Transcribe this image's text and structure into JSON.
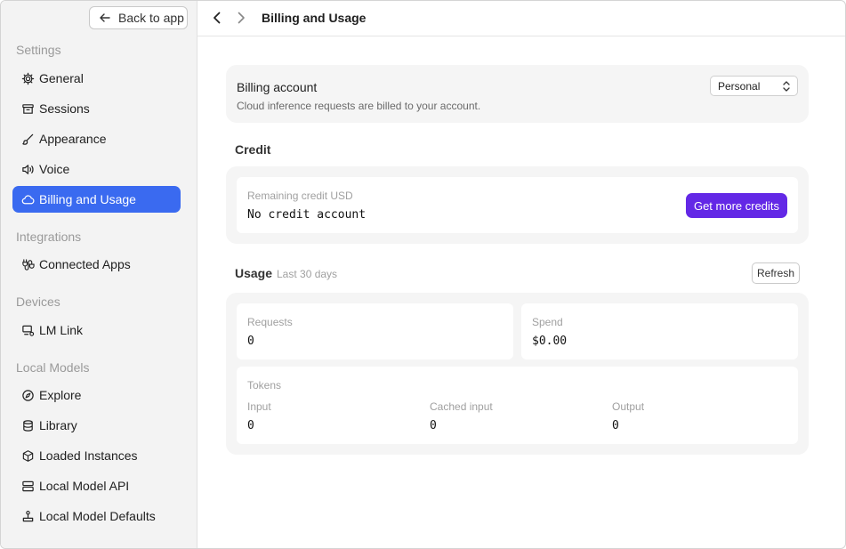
{
  "sidebar": {
    "back_label": "Back to app",
    "sections": {
      "settings": "Settings",
      "integrations": "Integrations",
      "devices": "Devices",
      "local_models": "Local Models"
    },
    "items": {
      "general": "General",
      "sessions": "Sessions",
      "appearance": "Appearance",
      "voice": "Voice",
      "billing": "Billing and Usage",
      "connected_apps": "Connected Apps",
      "lm_link": "LM Link",
      "explore": "Explore",
      "library": "Library",
      "loaded_instances": "Loaded Instances",
      "local_model_api": "Local Model API",
      "local_model_defaults": "Local Model Defaults"
    }
  },
  "header": {
    "title": "Billing and Usage"
  },
  "billing_account": {
    "title": "Billing account",
    "description": "Cloud inference requests are billed to your account.",
    "selected": "Personal"
  },
  "credit": {
    "title": "Credit",
    "label": "Remaining credit USD",
    "value": "No credit account",
    "button": "Get more credits"
  },
  "usage": {
    "title": "Usage",
    "period": "Last 30 days",
    "refresh": "Refresh",
    "requests_label": "Requests",
    "requests_value": "0",
    "spend_label": "Spend",
    "spend_value": "$0.00",
    "tokens_label": "Tokens",
    "input_label": "Input",
    "input_value": "0",
    "cached_label": "Cached input",
    "cached_value": "0",
    "output_label": "Output",
    "output_value": "0"
  },
  "colors": {
    "accent": "#3a6af0",
    "primary_button": "#6328e6"
  }
}
